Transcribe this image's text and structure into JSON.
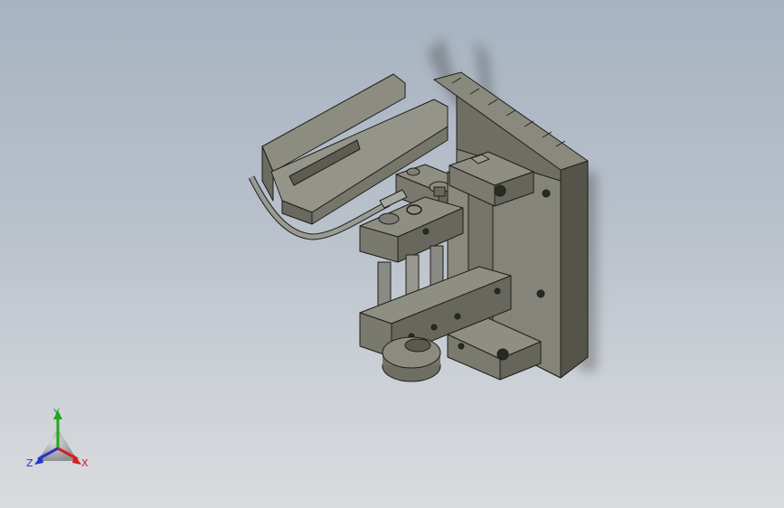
{
  "viewport": {
    "background_top": "#a7b3c1",
    "background_bottom": "#d9dbde"
  },
  "model": {
    "body_color": "#7d7c70",
    "edge_color": "#1e1e1a",
    "cable_color": "#9a9a94"
  },
  "triad": {
    "x_label": "X",
    "y_label": "Y",
    "z_label": "Z",
    "x_color": "#d42020",
    "y_color": "#1fa81f",
    "z_color": "#2636c8"
  }
}
